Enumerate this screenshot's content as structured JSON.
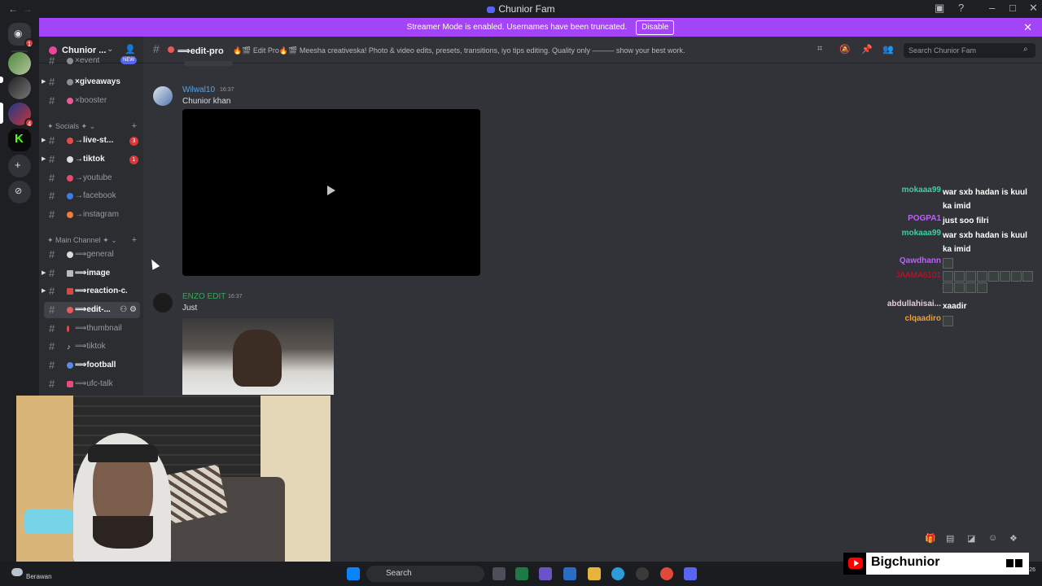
{
  "window": {
    "title": "Chunior Fam",
    "back": "←",
    "forward": "→"
  },
  "banner": {
    "text": "Streamer Mode is enabled. Usernames have been truncated.",
    "button": "Disable"
  },
  "guild": {
    "name": "Chunior ..."
  },
  "sidebar": {
    "top_channels": [
      {
        "label": "×event",
        "badge": "NEW",
        "color": "#8b8e94"
      },
      {
        "label": "×giveaways",
        "color": "#8b8e94",
        "unread": true
      },
      {
        "label": "×booster",
        "color": "#e85a9a"
      }
    ],
    "categories": [
      {
        "label": "✦ Socials ✦"
      },
      {
        "label": "✦ Main Channel ✦"
      }
    ],
    "social_channels": [
      {
        "label": "→live-st...",
        "count": "3",
        "color": "#e84a4a",
        "unread": true
      },
      {
        "label": "→tiktok",
        "count": "1",
        "color": "#dcdcdc",
        "unread": true
      },
      {
        "label": "→youtube",
        "color": "#e84a6a"
      },
      {
        "label": "→facebook",
        "color": "#3d7ce8"
      },
      {
        "label": "→instagram",
        "color": "#f07b3a"
      }
    ],
    "main_channels": [
      {
        "label": "⟹general",
        "color": "#dcdcdc"
      },
      {
        "label": "⟹image",
        "color": "#bbbbbb",
        "unread": true
      },
      {
        "label": "⟹reaction-c...",
        "color": "#d04a4a",
        "unread": true
      },
      {
        "label": "⟹edit-...",
        "color": "#e85a5a",
        "active": true
      },
      {
        "label": "⟹thumbnail",
        "color": "#e84a4a"
      },
      {
        "label": "⟹tiktok",
        "color": "#dcdcdc"
      },
      {
        "label": "⟹football",
        "color": "#5a8be8",
        "unread": true
      },
      {
        "label": "⟹ufc-talk",
        "color": "#e84a7a"
      }
    ]
  },
  "channel_header": {
    "name": "⟹edit-pro",
    "topic": "🔥🎬 Edit Pro🔥🎬 Meesha creativeska! Photo & video edits, presets, transitions, iyo tips editing. Quality only ——— show your best work.",
    "search_placeholder": "Search Chunior Fam"
  },
  "messages": [
    {
      "author": "Wilwal10",
      "time": "16:37",
      "text": "Chunior khan",
      "author_color": "#5ba3e6",
      "attachment": "video"
    },
    {
      "author": "ENZO EDIT",
      "time": "16:37",
      "text": "Just",
      "author_color": "#3ba55c",
      "attachment": "image"
    }
  ],
  "overlay_chat": [
    {
      "name": "mokaaa99",
      "text": "war sxb hadan is kuul ka imid",
      "color": "#3fcfa0"
    },
    {
      "name": "POGPA1",
      "text": "just soo filri",
      "color": "#b864f0"
    },
    {
      "name": "mokaaa99",
      "text": "war sxb hadan is kuul ka imid",
      "color": "#3fcfa0"
    },
    {
      "name": "Qawdhann",
      "text": "",
      "emotes": 1,
      "color": "#b864f0"
    },
    {
      "name": "JAAMA6101",
      "text": "",
      "emotes": 12,
      "color": "#d0102a"
    },
    {
      "name": "abdullahisai...",
      "text": "xaadir",
      "color": "#e6c9e0"
    },
    {
      "name": "clqaadiro",
      "text": "",
      "emotes": 1,
      "color": "#f0a030"
    }
  ],
  "taskbar": {
    "weather": "Berawan",
    "search": "Search",
    "date": "09/02/2026"
  },
  "stream_overlay": {
    "channel_name": "Bigchunior"
  }
}
